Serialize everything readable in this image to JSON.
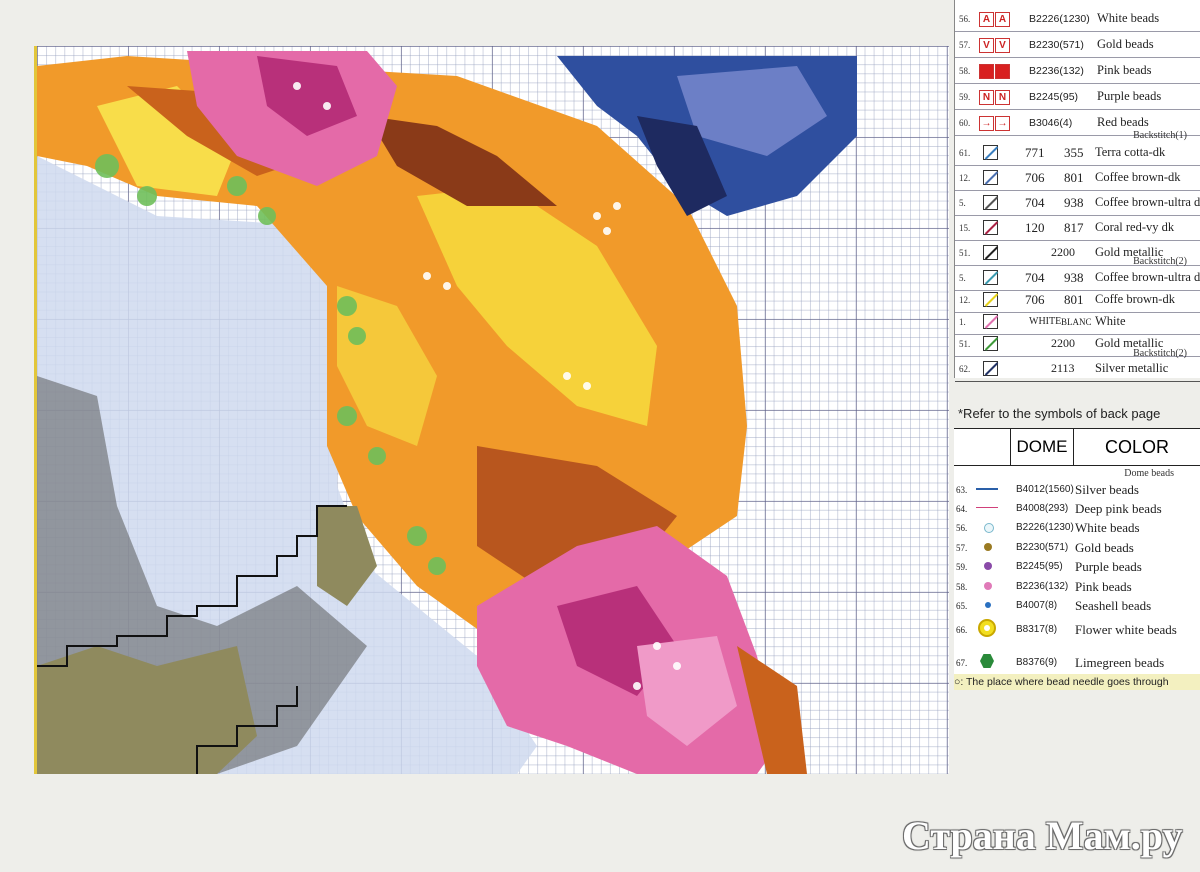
{
  "bead_rows": [
    {
      "num": "56.",
      "sym": "A",
      "code": "B2226(1230)",
      "name": "White  beads"
    },
    {
      "num": "57.",
      "sym": "V",
      "code": "B2230(571)",
      "name": "Gold beads"
    },
    {
      "num": "58.",
      "sym": "■",
      "code": "B2236(132)",
      "name": "Pink  beads"
    },
    {
      "num": "59.",
      "sym": "N",
      "code": "B2245(95)",
      "name": "Purple  beads"
    },
    {
      "num": "60.",
      "sym": "→",
      "code": "B3046(4)",
      "name": "Red beads"
    }
  ],
  "backstitch1_label": "Backstitch(1)",
  "backstitch1_rows": [
    {
      "num": "61.",
      "a": "771",
      "b": "355",
      "name": "Terra cotta-dk",
      "color": "#3a7fc0"
    },
    {
      "num": "12.",
      "a": "706",
      "b": "801",
      "name": "Coffee brown-dk",
      "color": "#4a6fb0"
    },
    {
      "num": "5.",
      "a": "704",
      "b": "938",
      "name": "Coffee brown-ultra dk",
      "color": "#555555"
    },
    {
      "num": "15.",
      "a": "120",
      "b": "817",
      "name": "Coral red-vy dk",
      "color": "#aa2244"
    }
  ],
  "gold_row1": {
    "num": "51.",
    "code": "2200",
    "name": "Gold metallic",
    "color": "#222222"
  },
  "backstitch2_label": "Backstitch(2)",
  "backstitch2_rows": [
    {
      "num": "5.",
      "a": "704",
      "b": "938",
      "name": "Coffee brown-ultra dk",
      "color": "#3a9ab0"
    },
    {
      "num": "12.",
      "a": "706",
      "b": "801",
      "name": "Coffe brown-dk",
      "color": "#e6d21a"
    },
    {
      "num": "1.",
      "a": "WHITE",
      "b": "BLANC",
      "name": "White",
      "color": "#e070b0"
    }
  ],
  "gold_row2": {
    "num": "51.",
    "code": "2200",
    "name": "Gold metallic",
    "color": "#3f9a3a"
  },
  "backstitch3_label": "Backstitch(2)",
  "silver_row": {
    "num": "62.",
    "code": "2113",
    "name": "Silver metallic",
    "color": "#223366"
  },
  "note_text": "*Refer to the symbols of back page",
  "dome": {
    "header_dome": "DOME",
    "header_color": "COLOR",
    "sub_label": "Dome beads",
    "rows": [
      {
        "num": "63.",
        "code": "B4012(1560)",
        "name": "Silver beads",
        "color": "#2a5fa8",
        "shape": "line"
      },
      {
        "num": "64.",
        "code": "B4008(293)",
        "name": "Deep pink beads",
        "color": "#d0407a",
        "shape": "line"
      },
      {
        "num": "56.",
        "code": "B2226(1230)",
        "name": "White beads",
        "color": "#bfe4ef",
        "shape": "circle"
      },
      {
        "num": "57.",
        "code": "B2230(571)",
        "name": "Gold beads",
        "color": "#9a7a22",
        "shape": "dot"
      },
      {
        "num": "59.",
        "code": "B2245(95)",
        "name": "Purple beads",
        "color": "#8a4aa8",
        "shape": "dot"
      },
      {
        "num": "58.",
        "code": "B2236(132)",
        "name": "Pink beads",
        "color": "#e07ab8",
        "shape": "dot"
      },
      {
        "num": "65.",
        "code": "B4007(8)",
        "name": "Seashell beads",
        "color": "#2a70c0",
        "shape": "small"
      },
      {
        "num": "66.",
        "code": "B8317(8)",
        "name": "Flower white beads",
        "color": "#f2de20",
        "shape": "flower"
      },
      {
        "num": "67.",
        "code": "B8376(9)",
        "name": "Limegreen beads",
        "color": "#2a8a3a",
        "shape": "hex"
      }
    ]
  },
  "bead_needle_note": "○: The place where bead needle goes through",
  "watermark": "Страна Мам.ру"
}
